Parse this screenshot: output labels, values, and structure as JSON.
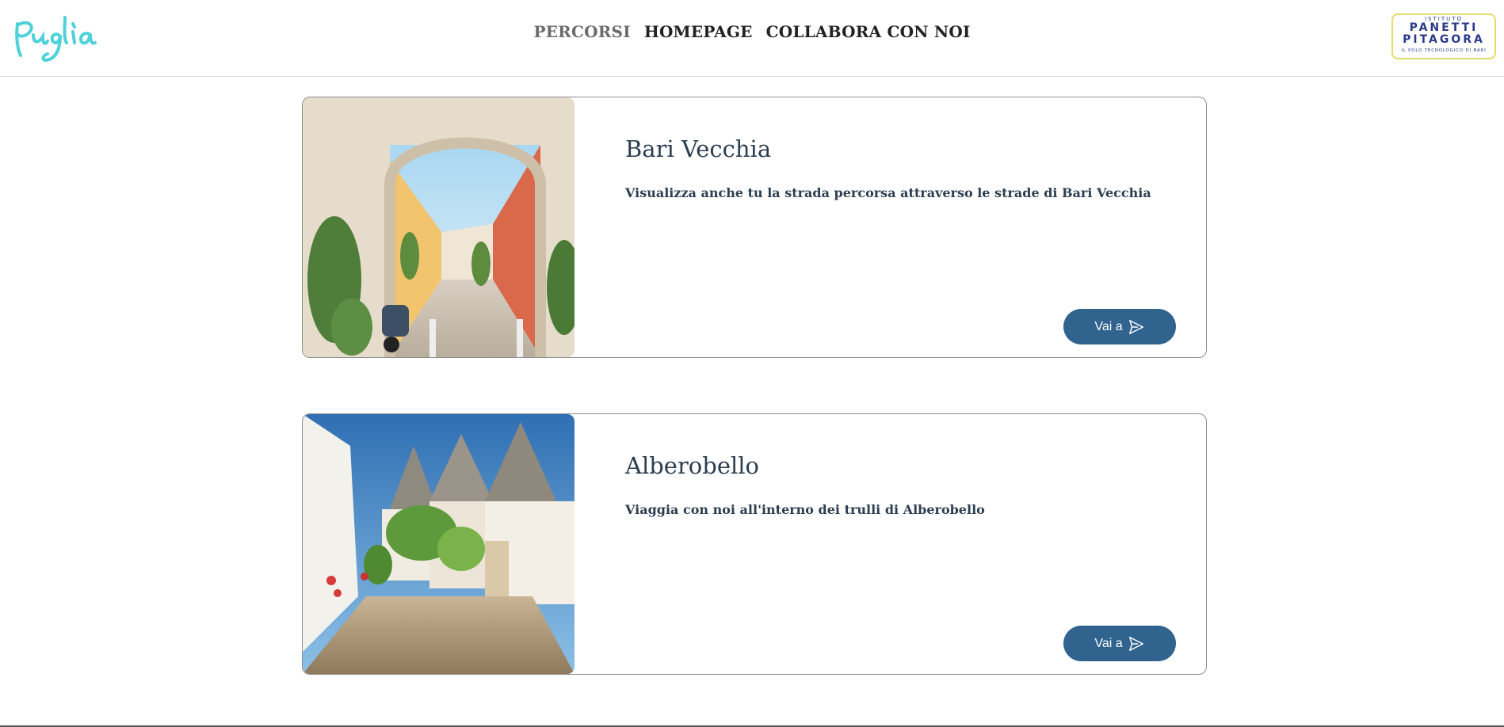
{
  "header": {
    "nav": [
      {
        "label": "PERCORSI",
        "active": true
      },
      {
        "label": "HOMEPAGE",
        "active": false
      },
      {
        "label": "COLLABORA CON NOI",
        "active": false
      }
    ],
    "logo_right": {
      "line1": "ISTITUTO",
      "line2": "PANETTI",
      "line3": "PITAGORA",
      "line4": "IL POLO TECNOLOGICO DI BARI"
    }
  },
  "cards": [
    {
      "title": "Bari Vecchia",
      "text": "Visualizza anche tu la strada percorsa attraverso le strade di Bari Vecchia",
      "button": "Vai a"
    },
    {
      "title": "Alberobello",
      "text": "Viaggia con noi all'interno dei trulli di Alberobello",
      "button": "Vai a"
    }
  ],
  "colors": {
    "accent": "#30638e",
    "logo_left": "#4fd1d9",
    "logo_right_text": "#2b3a8a",
    "logo_right_border": "#e4dc6a",
    "text": "#2c3e50"
  },
  "icons": {
    "logo_left": "puglia-script-logo",
    "logo_right": "school-logo",
    "button_icon": "send-icon"
  }
}
